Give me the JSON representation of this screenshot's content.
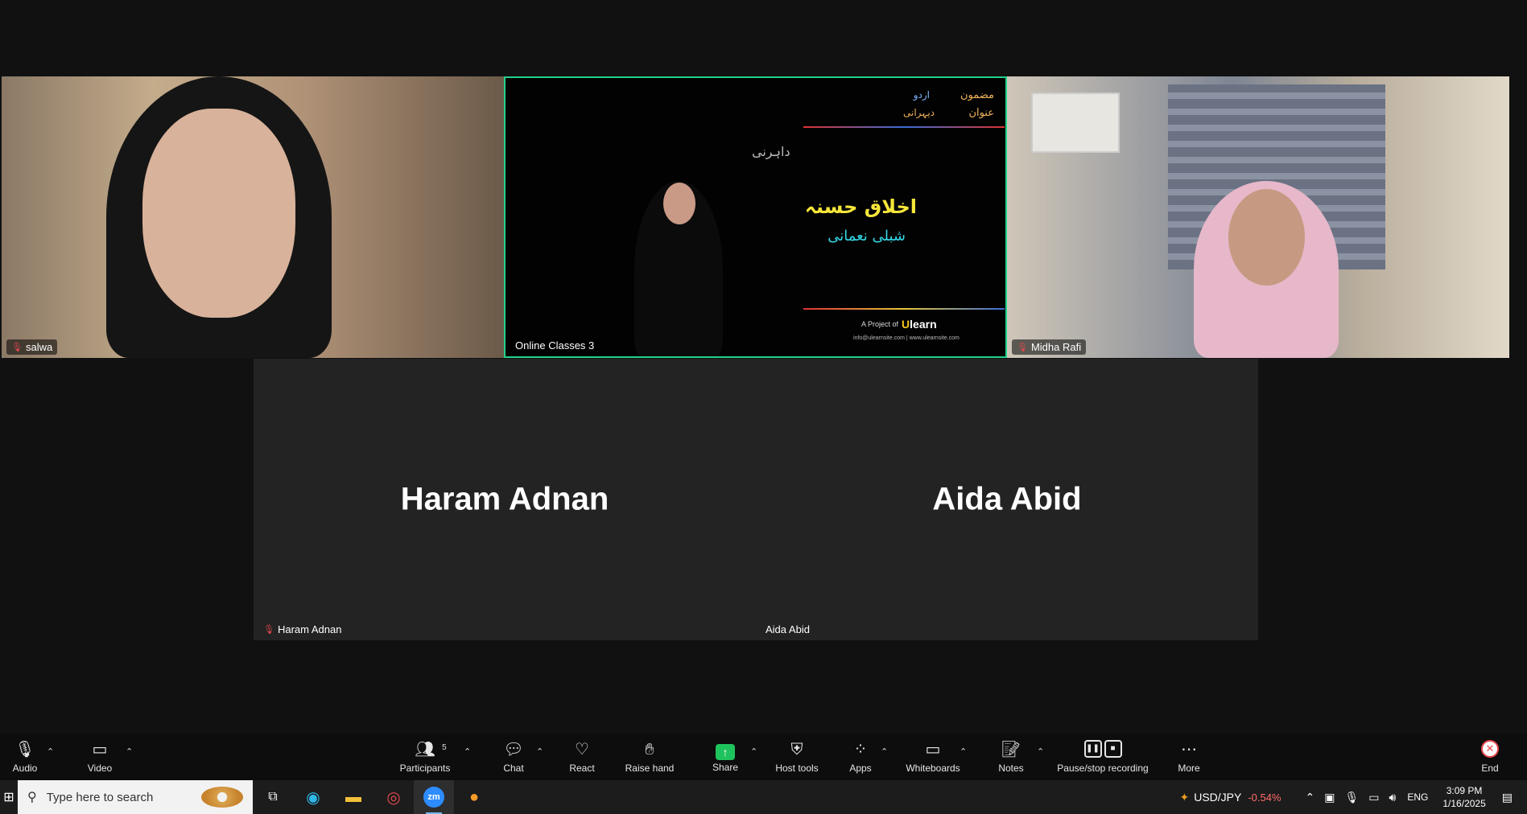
{
  "participants": [
    {
      "name": "salwa",
      "muted": true
    },
    {
      "name": "Online Classes 3",
      "muted": false
    },
    {
      "name": "Midha Rafi",
      "muted": true
    },
    {
      "name": "Haram Adnan",
      "muted": true
    },
    {
      "name": "Aida Abid",
      "muted": false
    }
  ],
  "slide": {
    "label_subject": "مضمون",
    "value_subject": "اردو",
    "label_title": "عنوان",
    "value_title": "دیہرانی",
    "side_text": "داہرنی",
    "main_title": "اخلاق حسنہ",
    "author": "شبلی نعمانی",
    "project_prefix": "A Project of",
    "brand": "learn",
    "brand_letter": "U",
    "contact": "info@ulearnsite.com | www.ulearnsite.com"
  },
  "toolbar": {
    "audio": "Audio",
    "video": "Video",
    "participants": "Participants",
    "participants_count": "5",
    "chat": "Chat",
    "react": "React",
    "raise_hand": "Raise hand",
    "share": "Share",
    "host_tools": "Host tools",
    "apps": "Apps",
    "whiteboards": "Whiteboards",
    "notes": "Notes",
    "pause_recording": "Pause/stop recording",
    "more": "More",
    "end": "End"
  },
  "taskbar": {
    "search_placeholder": "Type here to search",
    "ticker_symbol": "USD/JPY",
    "ticker_change": "-0.54%",
    "language": "ENG",
    "time": "3:09 PM",
    "date": "1/16/2025"
  },
  "colors": {
    "active_speaker": "#23d18b",
    "share_green": "#1fc35d",
    "end_red": "#e5484d",
    "ticker_red": "#ff6b6b"
  }
}
